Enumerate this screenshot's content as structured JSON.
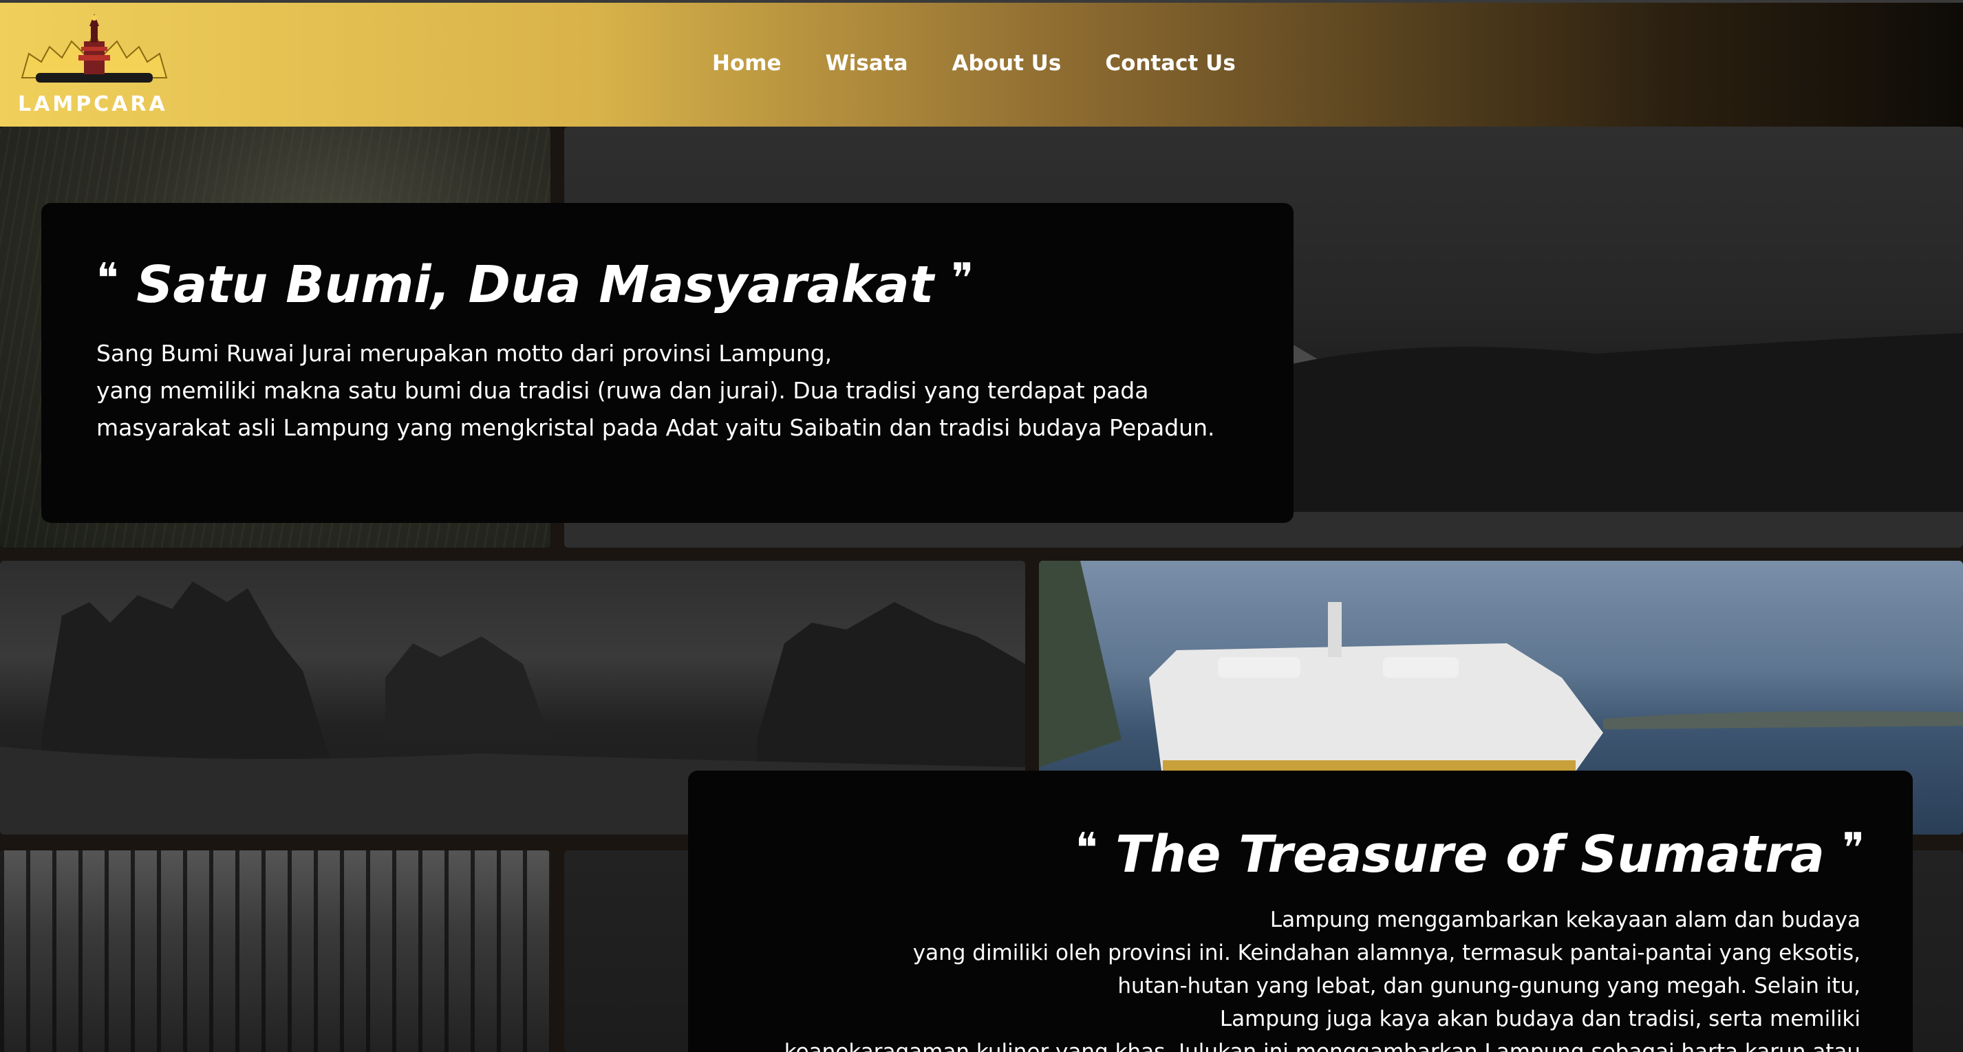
{
  "header": {
    "logo_text": "LAMPCARA",
    "nav": [
      {
        "label": "Home"
      },
      {
        "label": "Wisata"
      },
      {
        "label": "About Us"
      },
      {
        "label": "Contact Us"
      }
    ]
  },
  "section1": {
    "open_quote": "❝",
    "title": "Satu Bumi, Dua Masyarakat",
    "close_quote": "❞",
    "lines": [
      "Sang Bumi Ruwai Jurai merupakan motto dari provinsi Lampung,",
      "yang memiliki makna satu bumi dua tradisi (ruwa dan jurai). Dua tradisi yang terdapat pada",
      "masyarakat asli Lampung yang mengkristal pada Adat yaitu Saibatin dan tradisi budaya Pepadun."
    ]
  },
  "section2": {
    "open_quote": "❝",
    "title": "The Treasure of Sumatra",
    "close_quote": "❞",
    "lines": [
      "Lampung menggambarkan kekayaan alam dan budaya",
      "yang dimiliki oleh provinsi ini. Keindahan alamnya, termasuk pantai-pantai yang eksotis,",
      "hutan-hutan yang lebat, dan gunung-gunung yang megah. Selain itu,",
      "Lampung juga kaya akan budaya dan tradisi, serta memiliki",
      "keanekaragaman kuliner yang khas. Julukan ini menggambarkan Lampung sebagai harta karun atau"
    ]
  },
  "colors": {
    "header_gold": "#f0cf5a",
    "header_dark": "#0e0b07",
    "card_bg": "#050505",
    "text": "#ffffff"
  },
  "icons": {
    "logo": "lampung-siger-crown-icon"
  }
}
